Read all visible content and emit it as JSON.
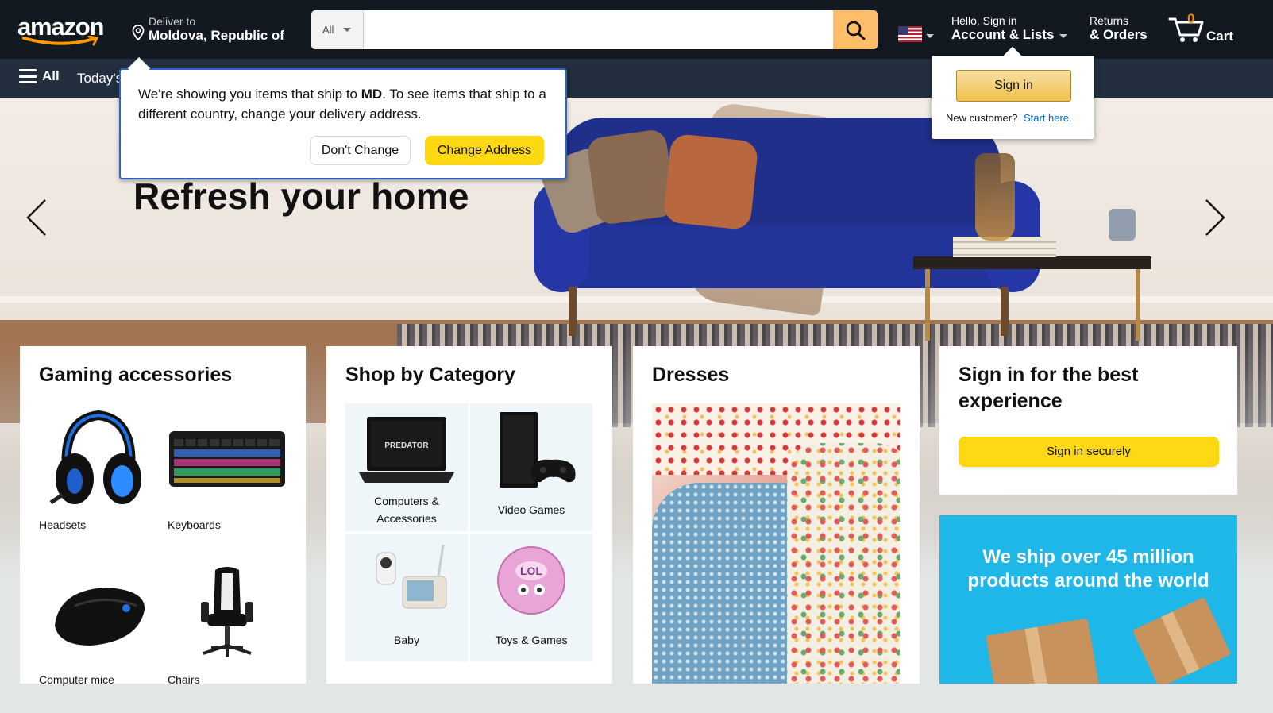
{
  "header": {
    "logo": "amazon",
    "deliver_to_label": "Deliver to",
    "deliver_to_location": "Moldova, Republic of",
    "search_category": "All",
    "search_placeholder": "",
    "flag_icon": "us-flag-icon",
    "account_greeting": "Hello, Sign in",
    "account_label": "Account & Lists",
    "returns_label": "Returns",
    "orders_label": "& Orders",
    "cart_count": "0",
    "cart_label": "Cart"
  },
  "subnav": {
    "all_label": "All",
    "today_label": "Today's"
  },
  "address_popover": {
    "message_part1": "We're showing you items that ship to ",
    "message_bold": "MD",
    "message_part2": ". To see items that ship to a different country, change your delivery address.",
    "dont_change_label": "Don't Change",
    "change_address_label": "Change Address"
  },
  "signin_popover": {
    "button_label": "Sign in",
    "new_customer_label": "New customer?",
    "start_here_label": "Start here."
  },
  "hero": {
    "title": "Refresh your home"
  },
  "cards": {
    "gaming": {
      "title": "Gaming accessories",
      "items": [
        {
          "label": "Headsets"
        },
        {
          "label": "Keyboards"
        },
        {
          "label": "Computer mice"
        },
        {
          "label": "Chairs"
        }
      ]
    },
    "category": {
      "title": "Shop by Category",
      "items": [
        {
          "label": "Computers & Accessories"
        },
        {
          "label": "Video Games"
        },
        {
          "label": "Baby"
        },
        {
          "label": "Toys & Games"
        }
      ]
    },
    "dresses": {
      "title": "Dresses"
    },
    "signin": {
      "title": "Sign in for the best experience",
      "button_label": "Sign in securely"
    },
    "ship": {
      "text": "We ship over 45 million products around the world"
    }
  },
  "colors": {
    "nav_top": "#131921",
    "nav_bottom": "#232f3e",
    "search_button": "#febd69",
    "primary_button": "#ffd814",
    "link": "#0066c0",
    "popover_border": "#2e63c6"
  }
}
